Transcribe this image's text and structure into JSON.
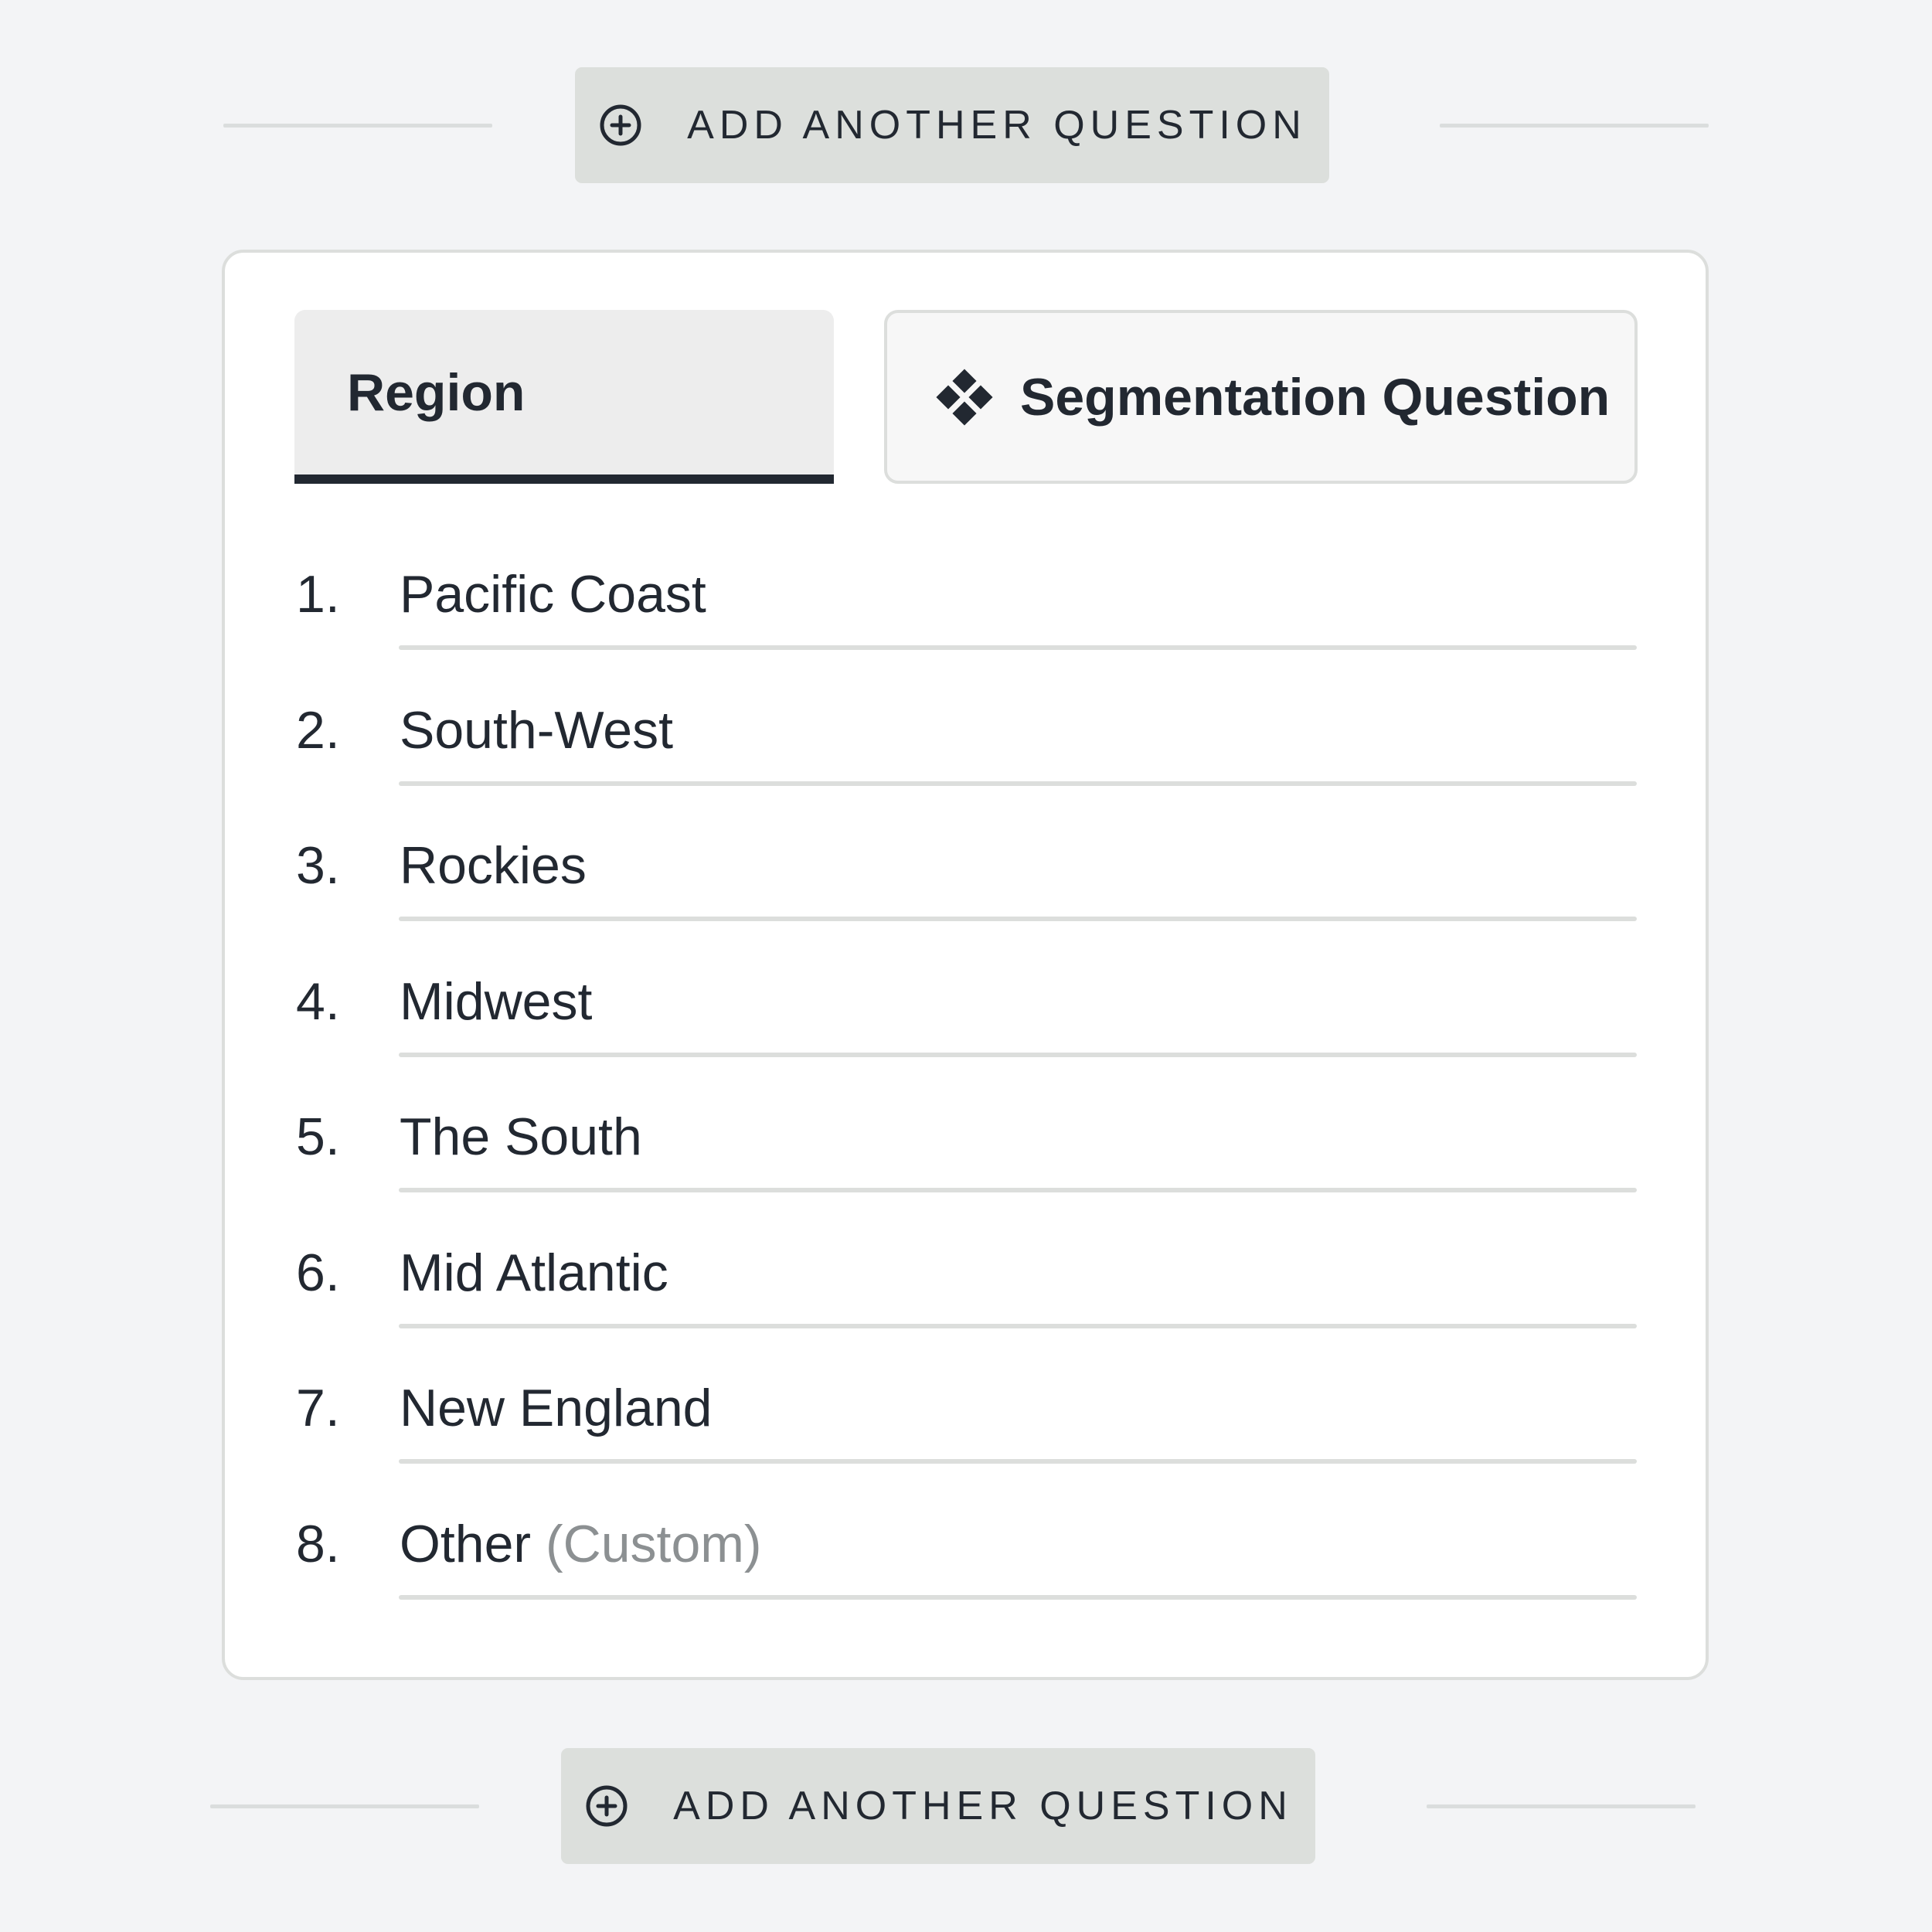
{
  "add_question_top": {
    "label": "ADD ANOTHER QUESTION",
    "icon": "plus-circle-icon"
  },
  "question": {
    "name": "Region",
    "type_label": "Segmentation Question",
    "type_icon": "segmentation-diamond-icon",
    "options": [
      {
        "number": "1.",
        "label": "Pacific Coast"
      },
      {
        "number": "2.",
        "label": "South-West"
      },
      {
        "number": "3.",
        "label": "Rockies"
      },
      {
        "number": "4.",
        "label": "Midwest"
      },
      {
        "number": "5.",
        "label": "The South"
      },
      {
        "number": "6.",
        "label": "Mid Atlantic"
      },
      {
        "number": "7.",
        "label": "New England"
      },
      {
        "number": "8.",
        "label": "Other",
        "suffix": "(Custom)"
      }
    ]
  },
  "add_question_bottom": {
    "label": "ADD ANOTHER QUESTION",
    "icon": "plus-circle-icon"
  },
  "colors": {
    "background": "#f3f4f6",
    "card": "#ffffff",
    "button": "#dcdfdc",
    "text": "#222831",
    "muted_text": "#8c9092",
    "divider": "#dcdedc",
    "active_tab_underline": "#222831"
  }
}
